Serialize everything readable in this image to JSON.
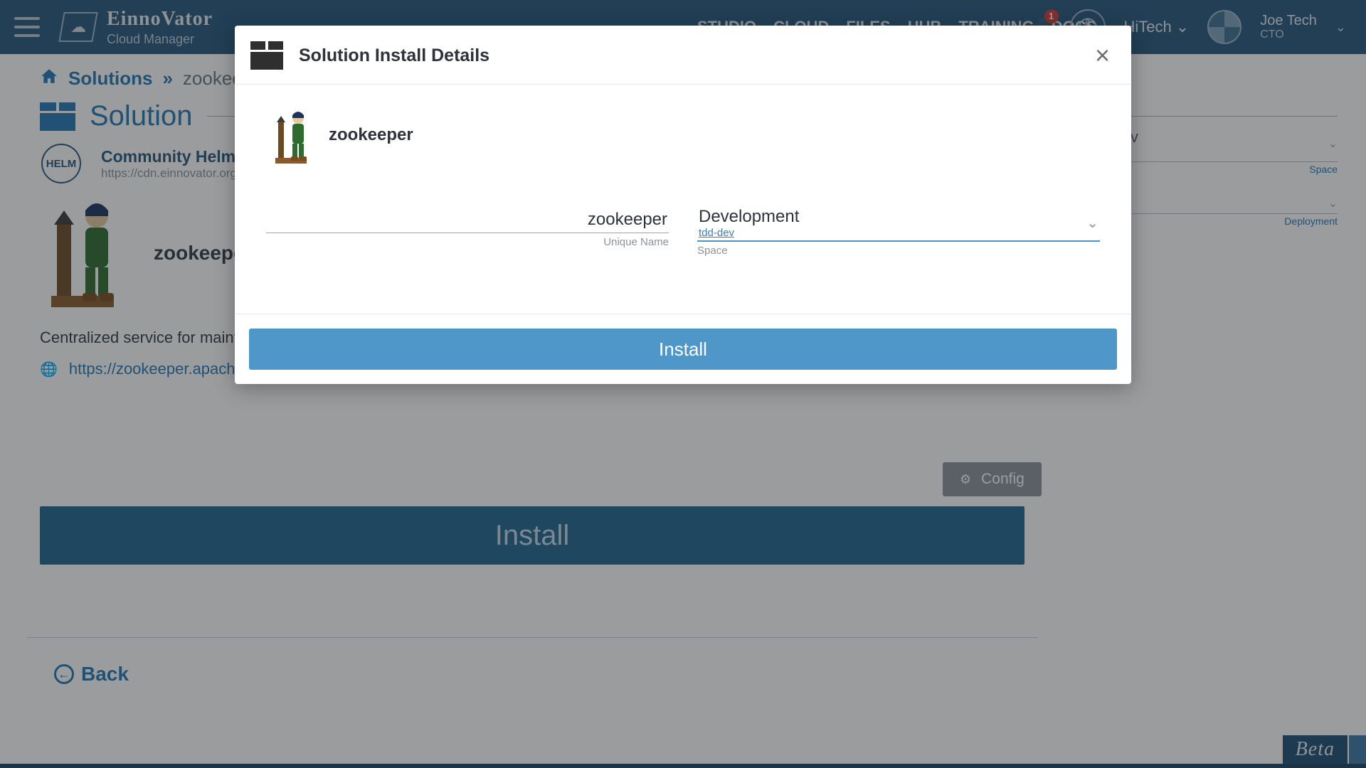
{
  "header": {
    "brand_title": "EinnoVator",
    "brand_sub": "Cloud Manager",
    "nav": [
      "STUDIO",
      "CLOUD",
      "FILES",
      "HUB",
      "TRAINING",
      "DOCS"
    ],
    "notif_count": "1",
    "tenant": "HiTech",
    "user_name": "Joe Tech",
    "user_role": "CTO"
  },
  "breadcrumb": {
    "root": "Solutions",
    "current": "zookeeper"
  },
  "section_title": "Solution",
  "helm": {
    "badge": "HELM",
    "title": "Community Helm Charts",
    "url": "https://cdn.einnovator.org/charts"
  },
  "solution": {
    "name": "zookeeper",
    "desc": "Centralized service for maintaining configuration info",
    "link": "https://zookeeper.apache.org/"
  },
  "buttons": {
    "config": "Config",
    "install": "Install",
    "back": "Back"
  },
  "context": {
    "cluster_main": "st-dev",
    "cluster_sub": "-dev",
    "label_space": "Space",
    "label_deploy": "Deployment"
  },
  "beta": "Beta",
  "modal": {
    "title": "Solution Install Details",
    "name": "zookeeper",
    "unique_name_value": "zookeeper",
    "unique_name_hint": "Unique Name",
    "space_value": "Development",
    "space_sub": "tdd-dev",
    "space_hint": "Space",
    "install": "Install"
  }
}
